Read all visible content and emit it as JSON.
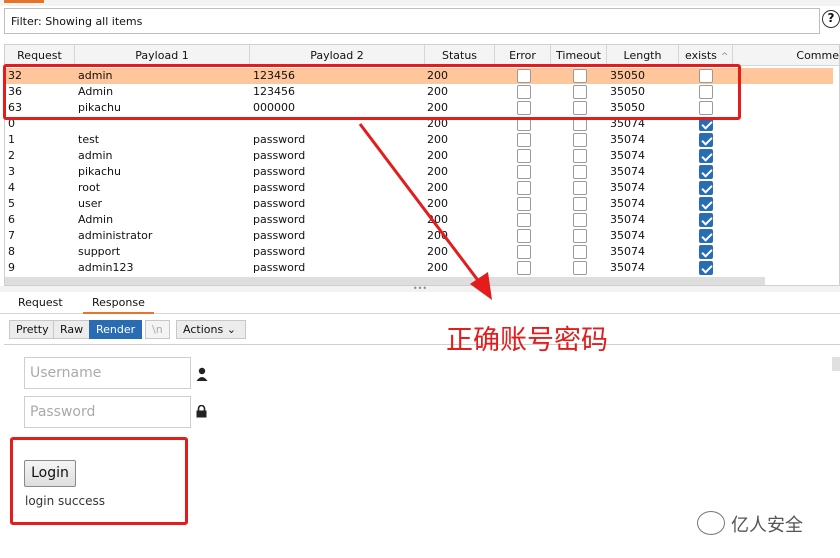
{
  "filter": {
    "text": "Filter: Showing all items"
  },
  "help_glyph": "?",
  "table": {
    "columns": [
      "Request",
      "Payload 1",
      "Payload 2",
      "Status",
      "Error",
      "Timeout",
      "Length",
      "exists",
      "Comme"
    ],
    "sort_glyph": "^",
    "rows": [
      {
        "request": "32",
        "p1": "admin",
        "p2": "123456",
        "status": "200",
        "error": false,
        "timeout": false,
        "length": "35050",
        "exists": false,
        "selected": true
      },
      {
        "request": "36",
        "p1": "Admin",
        "p2": "123456",
        "status": "200",
        "error": false,
        "timeout": false,
        "length": "35050",
        "exists": false,
        "selected": false
      },
      {
        "request": "63",
        "p1": "pikachu",
        "p2": "000000",
        "status": "200",
        "error": false,
        "timeout": false,
        "length": "35050",
        "exists": false,
        "selected": false
      },
      {
        "request": "0",
        "p1": "",
        "p2": "",
        "status": "200",
        "error": false,
        "timeout": false,
        "length": "35074",
        "exists": true,
        "selected": false
      },
      {
        "request": "1",
        "p1": "test",
        "p2": "password",
        "status": "200",
        "error": false,
        "timeout": false,
        "length": "35074",
        "exists": true,
        "selected": false
      },
      {
        "request": "2",
        "p1": "admin",
        "p2": "password",
        "status": "200",
        "error": false,
        "timeout": false,
        "length": "35074",
        "exists": true,
        "selected": false
      },
      {
        "request": "3",
        "p1": "pikachu",
        "p2": "password",
        "status": "200",
        "error": false,
        "timeout": false,
        "length": "35074",
        "exists": true,
        "selected": false
      },
      {
        "request": "4",
        "p1": "root",
        "p2": "password",
        "status": "200",
        "error": false,
        "timeout": false,
        "length": "35074",
        "exists": true,
        "selected": false
      },
      {
        "request": "5",
        "p1": "user",
        "p2": "password",
        "status": "200",
        "error": false,
        "timeout": false,
        "length": "35074",
        "exists": true,
        "selected": false
      },
      {
        "request": "6",
        "p1": "Admin",
        "p2": "password",
        "status": "200",
        "error": false,
        "timeout": false,
        "length": "35074",
        "exists": true,
        "selected": false
      },
      {
        "request": "7",
        "p1": "administrator",
        "p2": "password",
        "status": "200",
        "error": false,
        "timeout": false,
        "length": "35074",
        "exists": true,
        "selected": false
      },
      {
        "request": "8",
        "p1": "support",
        "p2": "password",
        "status": "200",
        "error": false,
        "timeout": false,
        "length": "35074",
        "exists": true,
        "selected": false
      },
      {
        "request": "9",
        "p1": "admin123",
        "p2": "password",
        "status": "200",
        "error": false,
        "timeout": false,
        "length": "35074",
        "exists": true,
        "selected": false
      }
    ]
  },
  "divider_glyph": "•••",
  "tabs": {
    "request": "Request",
    "response": "Response"
  },
  "toolbar": {
    "pretty": "Pretty",
    "raw": "Raw",
    "render": "Render",
    "newline": "\\n",
    "actions": "Actions"
  },
  "render": {
    "username_placeholder": "Username",
    "password_placeholder": "Password",
    "login_label": "Login",
    "result": "login success"
  },
  "annotation": {
    "text": "正确账号密码",
    "color": "#e41c1c"
  },
  "watermark": {
    "text": "亿人安全"
  },
  "colors": {
    "selected_row": "#ffc59b",
    "accent": "#e8742b",
    "checkbox_on": "#2a6cb4"
  }
}
